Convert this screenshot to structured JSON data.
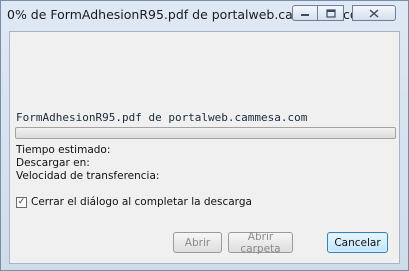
{
  "window": {
    "title": "0% de FormAdhesionR95.pdf de portalweb.cammesa.co...",
    "controls": {
      "minimize_icon": "minimize-icon",
      "maximize_icon": "maximize-icon",
      "close_icon": "close-icon"
    }
  },
  "download": {
    "file_line": "FormAdhesionR95.pdf de portalweb.cammesa.com",
    "progress": 0,
    "estimated_time_label": "Tiempo estimado:",
    "download_to_label": "Descargar en:",
    "transfer_speed_label": "Velocidad de transferencia:",
    "close_on_complete_label": "Cerrar el diálogo al completar la descarga",
    "close_on_complete_checked": true
  },
  "buttons": {
    "open": "Abrir",
    "open_folder": "Abrir carpeta",
    "cancel": "Cancelar"
  }
}
